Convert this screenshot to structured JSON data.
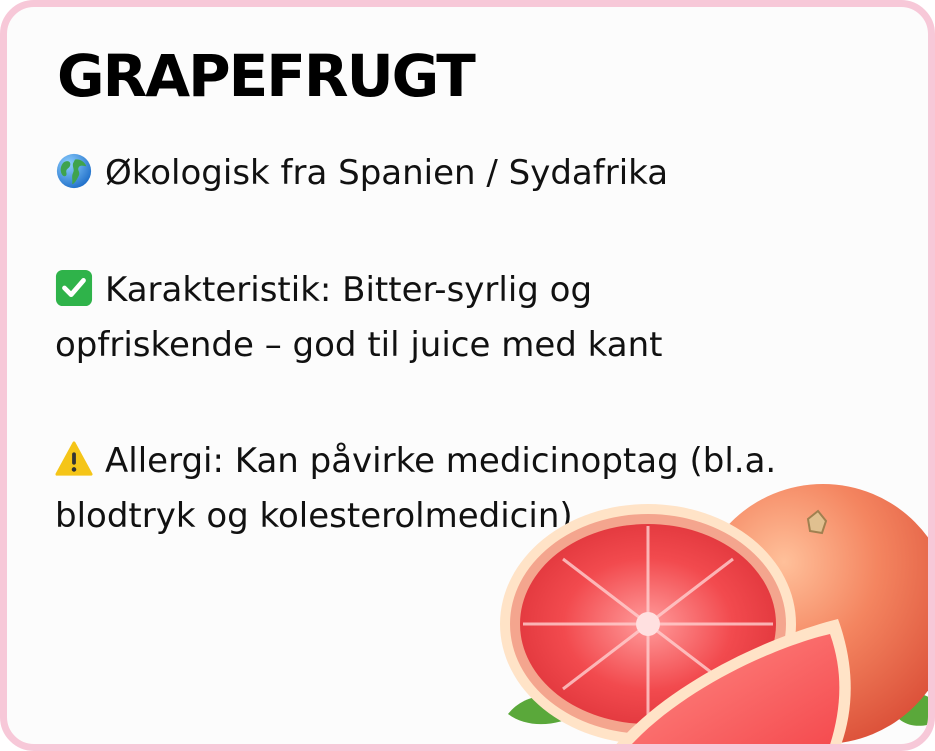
{
  "title": "GRAPEFRUGT",
  "origin": {
    "icon": "globe-icon",
    "text": "Økologisk fra Spanien / Sydafrika"
  },
  "characteristic": {
    "icon": "check-mark-icon",
    "line1": "Karakteristik: Bitter-syrlig og",
    "line2": "opfriskende – god til juice med kant"
  },
  "allergy": {
    "icon": "warning-icon",
    "line1": "Allergi: Kan påvirke medicinoptag (bl.a.",
    "line2": "blodtryk og kolesterolmedicin)"
  },
  "colors": {
    "border": "#f7c8d8",
    "check": "#2fb34a",
    "warning": "#f5c518",
    "grapefruit_peel": "#f2724f",
    "grapefruit_flesh": "#f0484c",
    "leaf": "#5aa83a"
  }
}
